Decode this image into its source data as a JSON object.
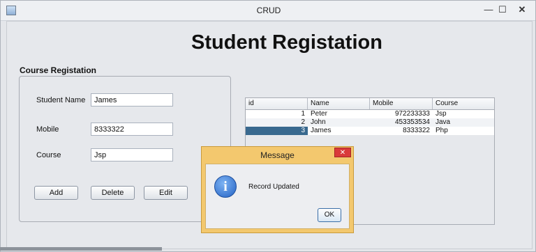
{
  "window": {
    "title": "CRUD",
    "controls": {
      "minimize": "—",
      "maximize": "☐",
      "close": "✕"
    }
  },
  "heading": "Student Registation",
  "form": {
    "group_title": "Course Registation",
    "student_name_label": "Student Name",
    "student_name_value": "James",
    "mobile_label": "Mobile",
    "mobile_value": "8333322",
    "course_label": "Course",
    "course_value": "Jsp",
    "add_label": "Add",
    "delete_label": "Delete",
    "edit_label": "Edit"
  },
  "table": {
    "columns": [
      "id",
      "Name",
      "Mobile",
      "Course"
    ],
    "rows": [
      {
        "id": "1",
        "name": "Peter",
        "mobile": "972233333",
        "course": "Jsp"
      },
      {
        "id": "2",
        "name": "John",
        "mobile": "453353534",
        "course": "Java"
      },
      {
        "id": "3",
        "name": "James",
        "mobile": "8333322",
        "course": "Php"
      }
    ],
    "selected_row": 2
  },
  "dialog": {
    "title": "Message",
    "close_glyph": "✕",
    "icon_glyph": "i",
    "message": "Record Updated",
    "ok_label": "OK"
  }
}
